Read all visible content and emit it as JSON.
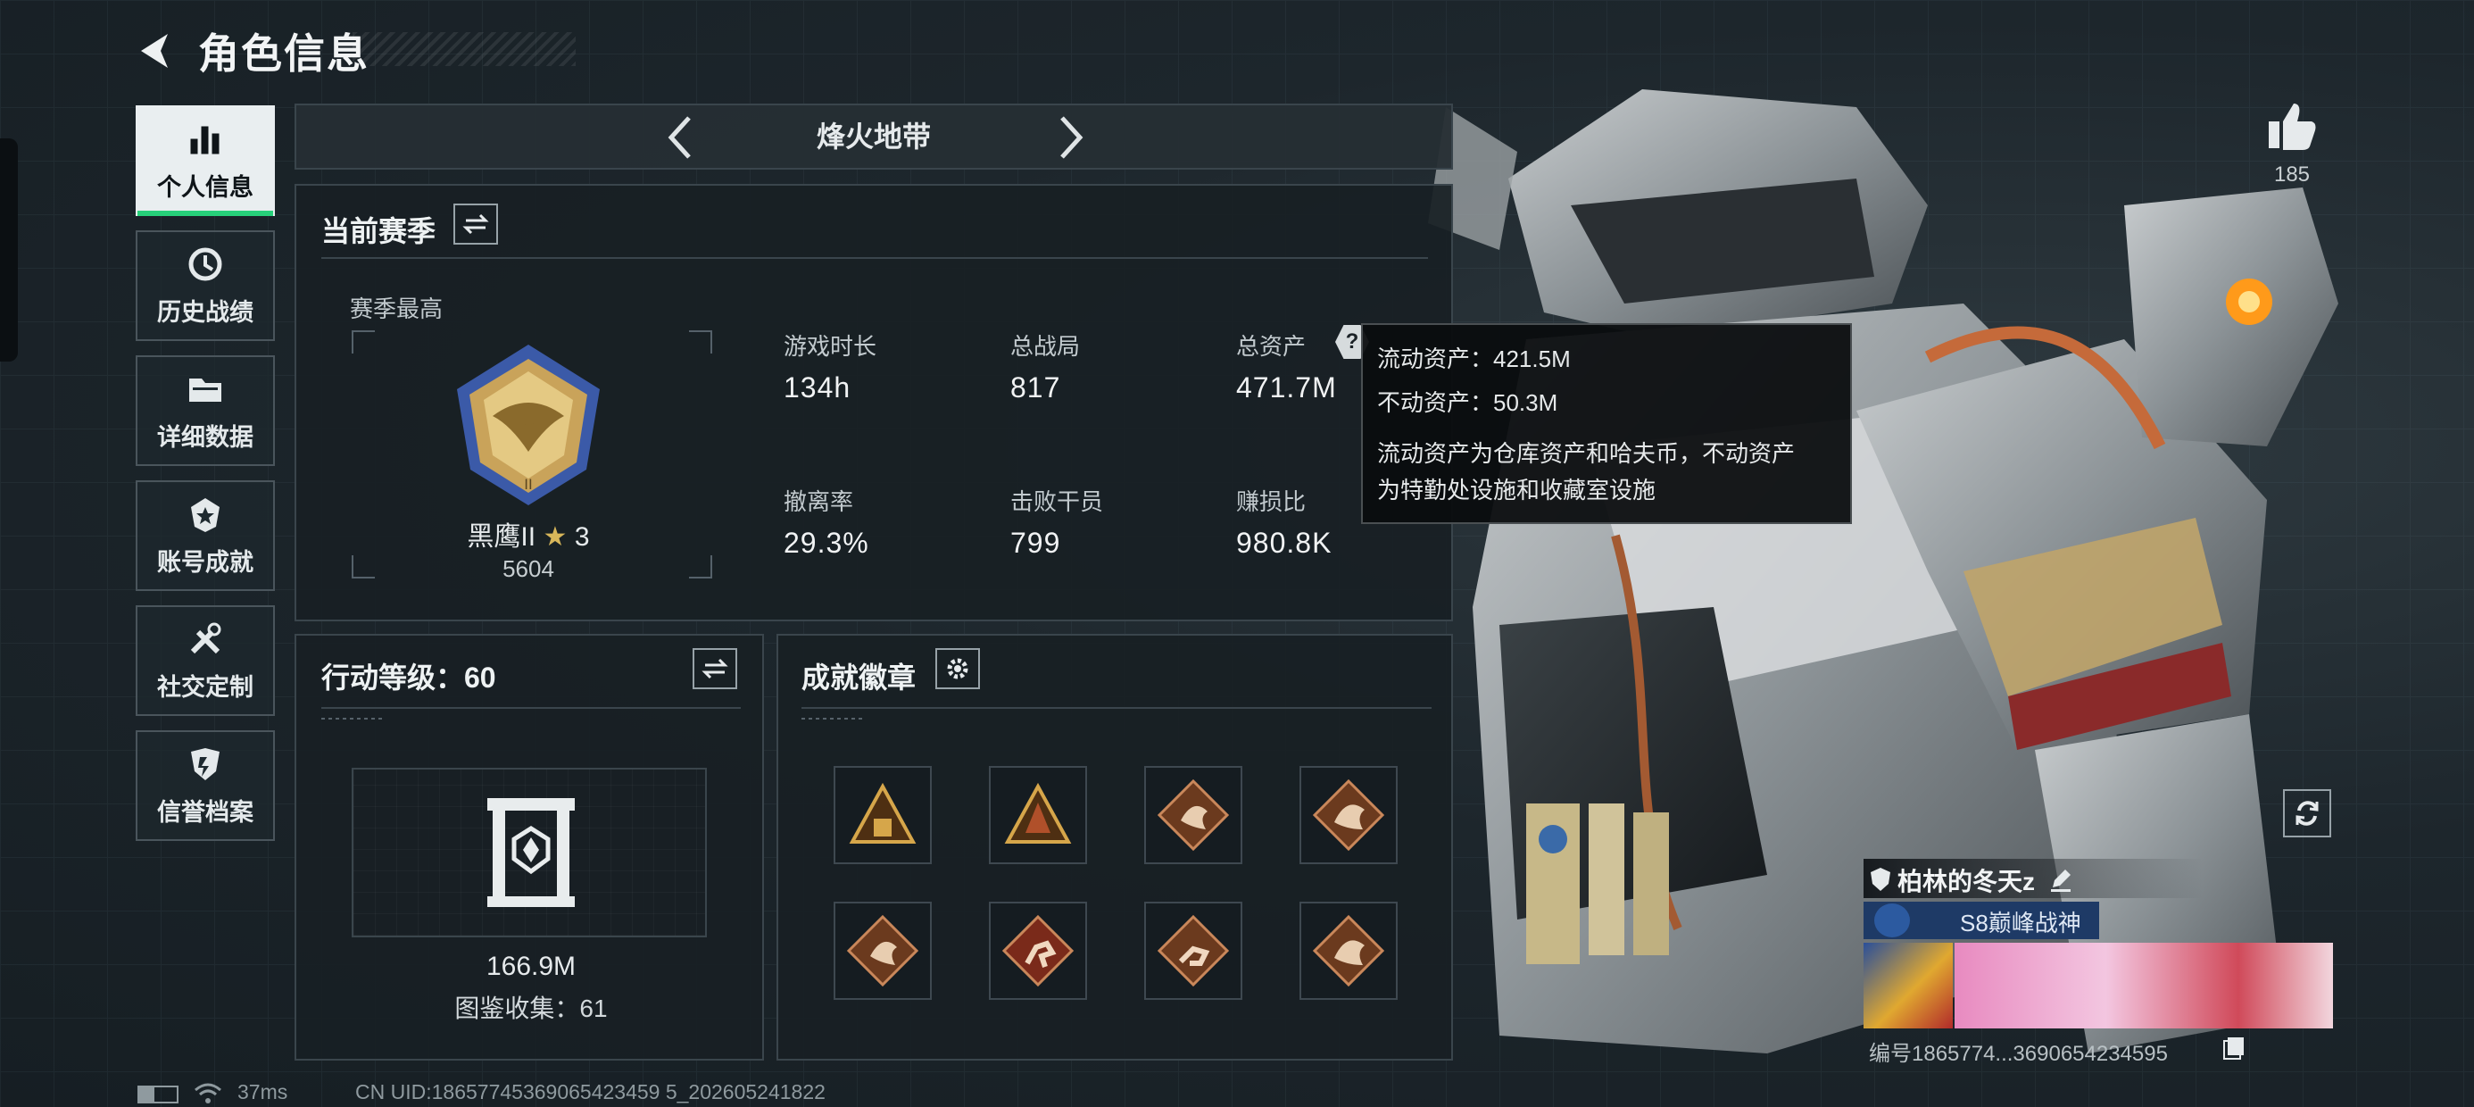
{
  "header": {
    "title": "角色信息"
  },
  "sidebar": {
    "items": [
      {
        "label": "个人信息",
        "icon": "bar-chart-icon",
        "active": true
      },
      {
        "label": "历史战绩",
        "icon": "history-icon"
      },
      {
        "label": "详细数据",
        "icon": "folder-icon"
      },
      {
        "label": "账号成就",
        "icon": "achievement-icon"
      },
      {
        "label": "社交定制",
        "icon": "tools-icon"
      },
      {
        "label": "信誉档案",
        "icon": "credit-shield-icon"
      }
    ]
  },
  "map": {
    "name": "烽火地带"
  },
  "season": {
    "title": "当前赛季",
    "best_label": "赛季最高",
    "rank_name": "黑鹰II",
    "rank_stars": "3",
    "rank_score": "5604",
    "stats": [
      {
        "label": "游戏时长",
        "value": "134h"
      },
      {
        "label": "总战局",
        "value": "817"
      },
      {
        "label": "总资产",
        "value": "471.7M"
      },
      {
        "label": "撤离率",
        "value": "29.3%"
      },
      {
        "label": "击败干员",
        "value": "799"
      },
      {
        "label": "赚损比",
        "value": "980.8K"
      }
    ]
  },
  "tooltip": {
    "liquid": "流动资产：421.5M",
    "fixed": "不动资产：50.3M",
    "desc_line1": "流动资产为仓库资产和哈夫币，不动资产",
    "desc_line2": "为特勤处设施和收藏室设施"
  },
  "action": {
    "title": "行动等级：60",
    "value": "166.9M",
    "collection": "图鉴收集：61"
  },
  "achievements": {
    "title": "成就徽章",
    "badge_count": 8
  },
  "likes": {
    "count": "185"
  },
  "player": {
    "name": "柏林的冬天z",
    "title": "S8巅峰战神",
    "id_text": "编号1865774...3690654234595"
  },
  "footer": {
    "ping": "37ms",
    "uid": "CN UID:18657745369065423459 5_202605241822"
  },
  "colors": {
    "accent": "#27d07a",
    "background": "#1c252c"
  }
}
